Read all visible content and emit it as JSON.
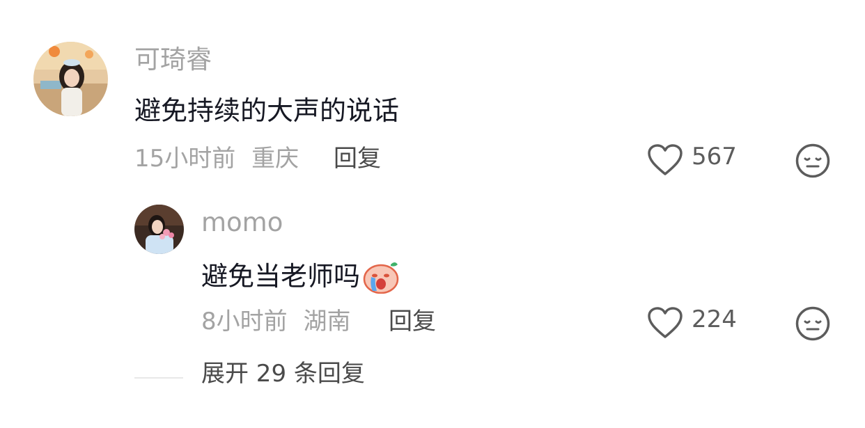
{
  "comments": [
    {
      "username": "可琦睿",
      "text": "避免持续的大声的说话",
      "time": "15小时前",
      "location": "重庆",
      "reply_label": "回复",
      "likes": "567"
    }
  ],
  "reply": {
    "username": "momo",
    "text": "避免当老师吗",
    "emoji_icon": "crying-sticker-emoji",
    "time": "8小时前",
    "location": "湖南",
    "reply_label": "回复",
    "likes": "224"
  },
  "expand": {
    "label": "展开 29 条回复"
  }
}
